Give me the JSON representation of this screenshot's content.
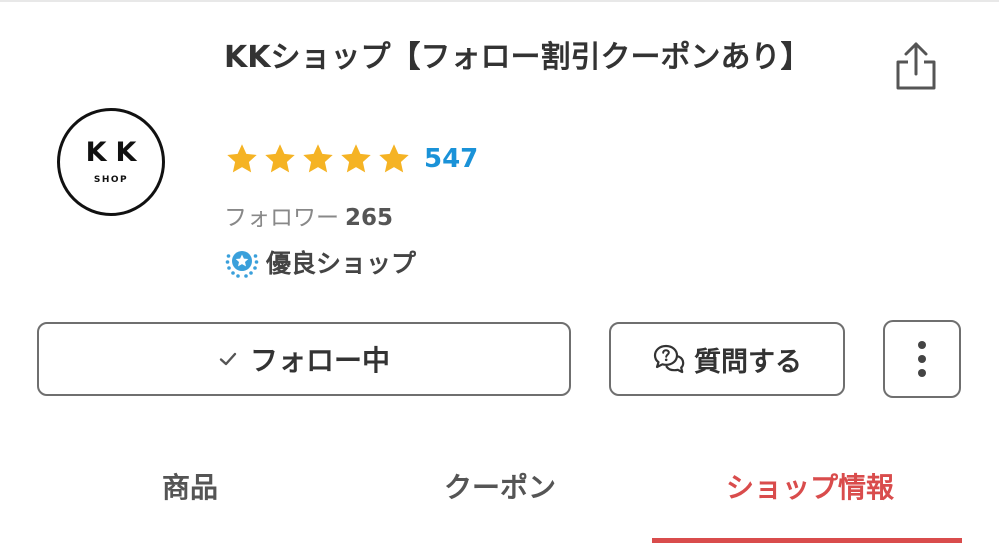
{
  "shop": {
    "logo_mark": "KK",
    "logo_sub": "SHOP",
    "title": "KKショップ【フォロー割引クーポンあり】",
    "rating_stars": 5,
    "review_count": "547",
    "followers_label": "フォロワー",
    "followers_count": "265",
    "badge_label": "優良ショップ"
  },
  "actions": {
    "follow_label": "フォロー中",
    "ask_label": "質問する"
  },
  "tabs": [
    {
      "label": "商品",
      "active": false
    },
    {
      "label": "クーポン",
      "active": false
    },
    {
      "label": "ショップ情報",
      "active": true
    }
  ],
  "colors": {
    "accent_red": "#d94c4c",
    "link_blue": "#1a92d8",
    "star_gold": "#f5b324",
    "badge_blue": "#3aa0db"
  },
  "icons": {
    "share": "share-icon",
    "star": "star-icon",
    "badge": "excellent-shop-badge-icon",
    "check": "check-icon",
    "question": "question-bubble-icon",
    "more": "more-vertical-icon"
  }
}
